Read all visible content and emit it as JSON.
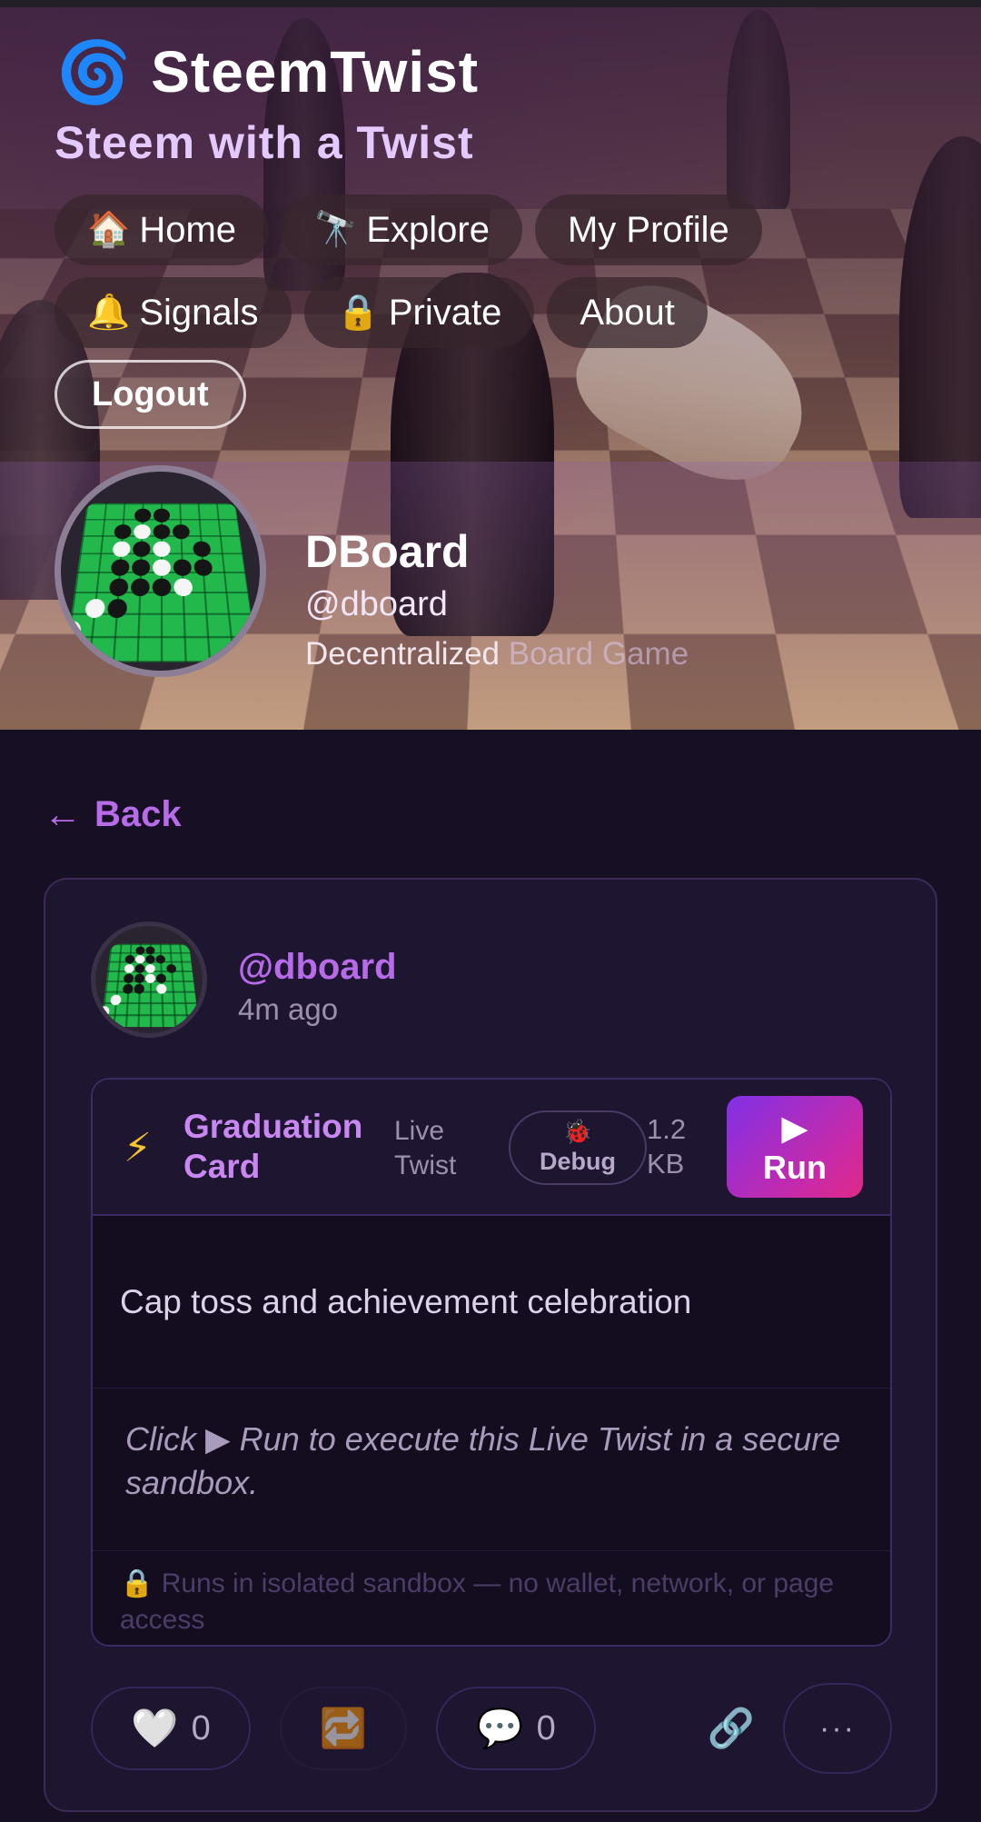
{
  "app": {
    "logo_icon": "🌀",
    "name": "SteemTwist",
    "tagline": "Steem with a Twist"
  },
  "nav": {
    "items": [
      {
        "icon": "🏠",
        "label": "Home"
      },
      {
        "icon": "🔭",
        "label": "Explore"
      },
      {
        "icon": "",
        "label": "My Profile"
      },
      {
        "icon": "🔔",
        "label": "Signals"
      },
      {
        "icon": "🔒",
        "label": "Private"
      },
      {
        "icon": "",
        "label": "About"
      }
    ],
    "logout_label": "Logout"
  },
  "profile": {
    "name": "DBoard",
    "handle": "@dboard",
    "description_main": "Decentralized ",
    "description_faded": "Board Game"
  },
  "back_label": "Back",
  "back_icon": "←",
  "post": {
    "author": "@dboard",
    "time": "4m ago",
    "twist": {
      "icon": "⚡",
      "title": "Graduation Card",
      "type": "Live Twist",
      "debug_icon": "🐞",
      "debug_label": "Debug",
      "size": "1.2 KB",
      "run_icon": "▶",
      "run_label": "Run",
      "description": "Cap toss and achievement celebration",
      "hint": "Click ▶ Run to execute this Live Twist in a secure sandbox.",
      "note": "🔒 Runs in isolated sandbox — no wallet, network, or page access"
    },
    "actions": {
      "like_icon": "🤍",
      "like_count": "0",
      "retwist_icon": "🔁",
      "comment_icon": "💬",
      "comment_count": "0",
      "link_icon": "🔗",
      "more_label": "···"
    }
  },
  "colors": {
    "accent": "#b86be8",
    "background": "#170f24",
    "card": "#1e1530",
    "run_gradient_start": "#8030e6",
    "run_gradient_end": "#e02a88"
  }
}
